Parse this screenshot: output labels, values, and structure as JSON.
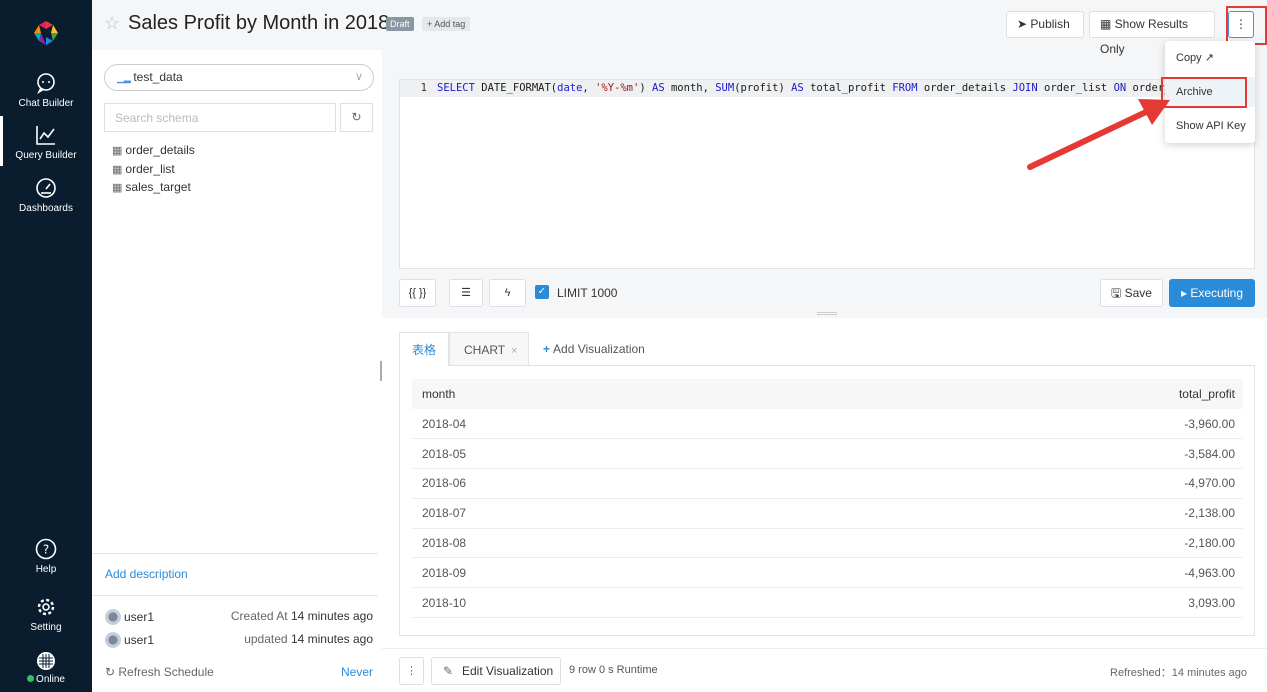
{
  "nav": {
    "items": [
      {
        "label": "Chat Builder",
        "icon": "chat-icon"
      },
      {
        "label": "Query Builder",
        "icon": "line-chart-icon"
      },
      {
        "label": "Dashboards",
        "icon": "gauge-icon"
      },
      {
        "label": "Help",
        "icon": "help-icon"
      },
      {
        "label": "Setting",
        "icon": "gear-icon"
      }
    ],
    "status": "Online"
  },
  "header": {
    "title": "Sales Profit by Month in 2018",
    "draft_badge": "Draft",
    "add_tag": "+ Add tag",
    "publish_label": "Publish",
    "show_results_label": "Show Results Only",
    "more_label": "⋮"
  },
  "dropdown": {
    "items": [
      "Copy",
      "Archive",
      "Show API Key"
    ]
  },
  "schema": {
    "datasource": "test_data",
    "search_placeholder": "Search schema",
    "tables": [
      "order_details",
      "order_list",
      "sales_target"
    ],
    "add_description": "Add description",
    "created": {
      "user": "user1",
      "prefix": "Created At",
      "time": "14 minutes ago"
    },
    "updated": {
      "user": "user1",
      "prefix": "updated",
      "time": "14 minutes ago"
    },
    "refresh_schedule": "Refresh Schedule",
    "refresh_value": "Never"
  },
  "editor": {
    "line_number": "1",
    "code": {
      "p1": "SELECT",
      "p2": " DATE_FORMAT(",
      "p3": "date",
      "p4": ", ",
      "p5": "'%Y-%m'",
      "p6": ") ",
      "p7": "AS",
      "p8": " month, ",
      "p9": "SUM",
      "p10": "(profit) ",
      "p11": "AS",
      "p12": " total_profit  ",
      "p13": "FROM",
      "p14": " order_details  ",
      "p15": "JOIN",
      "p16": " order_list ",
      "p17": "ON",
      "p18": " order_det"
    },
    "params_label": "{{ }}",
    "limit_label": "LIMIT 1000",
    "save_label": "Save",
    "execute_label": "Executing"
  },
  "results": {
    "tabs": {
      "table": "表格",
      "chart": "CHART",
      "add": "Add Visualization"
    },
    "columns": [
      "month",
      "total_profit"
    ],
    "rows": [
      [
        "2018-04",
        "-3,960.00"
      ],
      [
        "2018-05",
        "-3,584.00"
      ],
      [
        "2018-06",
        "-4,970.00"
      ],
      [
        "2018-07",
        "-2,138.00"
      ],
      [
        "2018-08",
        "-2,180.00"
      ],
      [
        "2018-09",
        "-4,963.00"
      ],
      [
        "2018-10",
        "3,093.00"
      ]
    ]
  },
  "footer": {
    "edit_visualization": "Edit Visualization",
    "stats": "9 row  0 s Runtime",
    "refreshed_label": "Refreshed：",
    "refreshed_time": "14 minutes ago"
  },
  "colors": {
    "accent": "#2a8bd8",
    "nav_bg": "#0a1d2e",
    "annotation": "#e53935"
  }
}
